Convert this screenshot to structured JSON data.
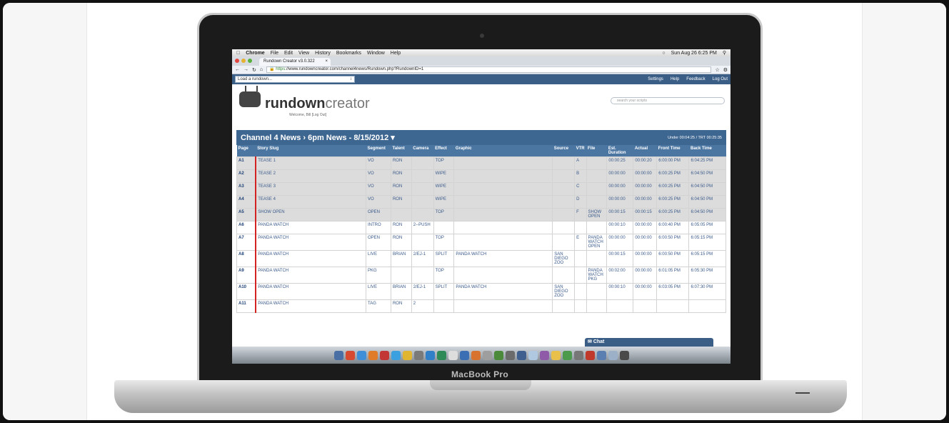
{
  "mac_menu": {
    "apple": "",
    "items": [
      "Chrome",
      "File",
      "Edit",
      "View",
      "History",
      "Bookmarks",
      "Window",
      "Help"
    ],
    "clock": "Sun Aug 26  6:25 PM"
  },
  "browser": {
    "tab_title": "Rundown Creator v3.0.322",
    "url_secure": "https",
    "url_rest": "://www.rundowncreator.com/channel4news/Rundown.php?RundownID=1"
  },
  "app": {
    "load_placeholder": "Load a rundown...",
    "nav": [
      "Settings",
      "Help",
      "Feedback",
      "Log Out"
    ],
    "logo_bold": "rundown",
    "logo_light": "creator",
    "welcome": "Welcome, Bill",
    "logout_small": "[Log Out]",
    "search_placeholder": "search your scripts",
    "rundown_title": "Channel 4 News › 6pm News - 8/15/2012 ▾",
    "timing": "Under 00:04:25 / TRT 00:25:35"
  },
  "table": {
    "headers": [
      "Page",
      "Story Slug",
      "Segment",
      "Talent",
      "Camera",
      "Effect",
      "Graphic",
      "Source",
      "VTR",
      "File",
      "Est. Duration",
      "Actual",
      "Front Time",
      "Back Time"
    ],
    "rows": [
      [
        "A1",
        "TEASE 1",
        "VO",
        "RON",
        "",
        "TOP",
        "",
        "",
        "A",
        "",
        "00:00:25",
        "00:00:20",
        "6:00:00 PM",
        "6:04:25 PM"
      ],
      [
        "A2",
        "TEASE 2",
        "VO",
        "RON",
        "",
        "WIPE",
        "",
        "",
        "B",
        "",
        "00:00:00",
        "00:00:00",
        "6:00:25 PM",
        "6:04:50 PM"
      ],
      [
        "A3",
        "TEASE 3",
        "VO",
        "RON",
        "",
        "WIPE",
        "",
        "",
        "C",
        "",
        "00:00:00",
        "00:00:00",
        "6:00:25 PM",
        "6:04:50 PM"
      ],
      [
        "A4",
        "TEASE 4",
        "VO",
        "RON",
        "",
        "WIPE",
        "",
        "",
        "D",
        "",
        "00:00:00",
        "00:00:00",
        "6:00:25 PM",
        "6:04:50 PM"
      ],
      [
        "A5",
        "SHOW OPEN",
        "OPEN",
        "",
        "",
        "TOP",
        "",
        "",
        "F",
        "SHOW OPEN",
        "00:00:15",
        "00:00:15",
        "6:00:25 PM",
        "6:04:50 PM"
      ],
      [
        "A6",
        "PANDA WATCH",
        "INTRO",
        "RON",
        "2--PUSH",
        "",
        "",
        "",
        "",
        "",
        "00:00:10",
        "00:00:00",
        "6:00:40 PM",
        "6:05:05 PM"
      ],
      [
        "A7",
        "PANDA WATCH",
        "OPEN",
        "RON",
        "",
        "TOP",
        "",
        "",
        "E",
        "PANDA WATCH OPEN",
        "00:00:00",
        "00:00:00",
        "6:00:50 PM",
        "6:05:15 PM"
      ],
      [
        "A8",
        "PANDA WATCH",
        "LIVE",
        "BRIAN",
        "2/EJ-1",
        "SPLIT",
        "PANDA WATCH",
        "SAN DIEGO ZOO",
        "",
        "",
        "00:00:15",
        "00:00:00",
        "6:00:50 PM",
        "6:05:15 PM"
      ],
      [
        "A9",
        "PANDA WATCH",
        "PKG",
        "",
        "",
        "TOP",
        "",
        "",
        "",
        "PANDA WATCH PKG",
        "00:02:00",
        "00:00:00",
        "6:01:05 PM",
        "6:05:30 PM"
      ],
      [
        "A10",
        "PANDA WATCH",
        "LIVE",
        "BRIAN",
        "2/EJ-1",
        "SPLIT",
        "PANDA WATCH",
        "SAN DIEGO ZOO",
        "",
        "",
        "00:00:10",
        "00:00:00",
        "6:03:05 PM",
        "6:07:30 PM"
      ],
      [
        "A11",
        "PANDA WATCH",
        "TAG",
        "RON",
        "2",
        "",
        "",
        "",
        "",
        "",
        "",
        "",
        "",
        ""
      ]
    ],
    "gray_rows": [
      0,
      1,
      2,
      3,
      4
    ]
  },
  "chat_label": "Chat",
  "laptop_brand": "MacBook Pro",
  "dock_colors": [
    "#4a6fa5",
    "#d84a2f",
    "#3f8fd8",
    "#e07b2a",
    "#c23636",
    "#3aa0e0",
    "#e0b531",
    "#7a7a7a",
    "#2f7fc9",
    "#2e8b57",
    "#dddddd",
    "#3c6eb4",
    "#d8732f",
    "#9e9e9e",
    "#4a8a3a",
    "#6b6b6b",
    "#3f5f8f",
    "#b0c8e0",
    "#8f5aa8",
    "#e8c04a",
    "#4c9a4c",
    "#777777",
    "#c0392b",
    "#5b7fb0",
    "#9cb0c8",
    "#4a4a4a"
  ]
}
